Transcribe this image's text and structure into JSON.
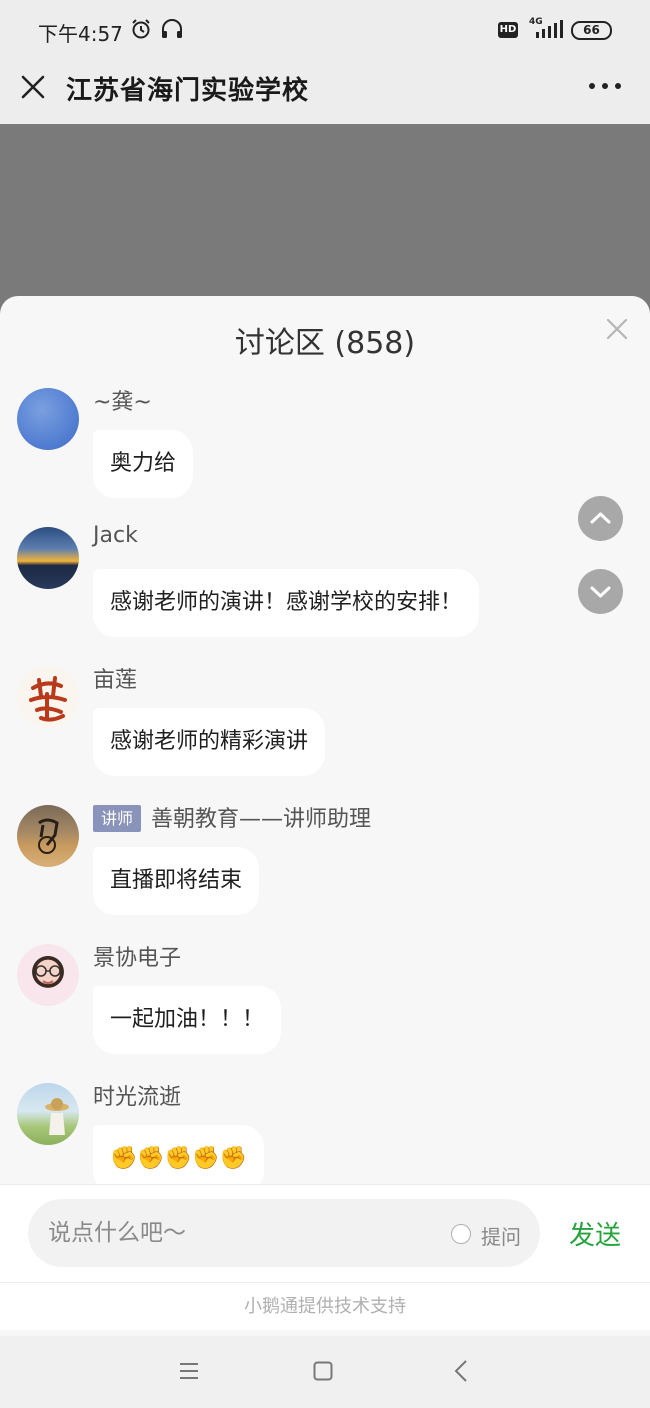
{
  "status_bar": {
    "time": "下午4:57",
    "network": "4G",
    "battery": "66",
    "hd_badge": "HD",
    "icons": [
      "alarm-icon",
      "headset-icon",
      "hd-icon",
      "signal-icon",
      "battery-icon"
    ]
  },
  "title_bar": {
    "title": "江苏省海门实验学校",
    "icons": [
      "close-icon",
      "more-icon"
    ]
  },
  "discussion": {
    "title": "讨论区 (858)",
    "messages": [
      {
        "user": "~龚~",
        "text": "奥力给",
        "avatar": "avatar-blue-circle"
      },
      {
        "user": "Jack",
        "text": "感谢老师的演讲！感谢学校的安排！",
        "avatar": "avatar-sunset"
      },
      {
        "user": "亩莲",
        "text": "感谢老师的精彩演讲",
        "avatar": "avatar-calligraphy"
      },
      {
        "user": "善朝教育——讲师助理",
        "role": "讲师",
        "text": "直播即将结束",
        "avatar": "avatar-desert-bike"
      },
      {
        "user": "景协电子",
        "text": "一起加油！！！",
        "avatar": "avatar-girl"
      },
      {
        "user": "时光流逝",
        "text": "✊✊✊✊✊",
        "avatar": "avatar-field"
      }
    ],
    "scroll_buttons": [
      "chevron-up-icon",
      "chevron-down-icon"
    ]
  },
  "composer": {
    "placeholder": "说点什么吧～",
    "value": "",
    "ask_label": "提问",
    "send_label": "发送"
  },
  "footer": {
    "support_text": "小鹅通提供技术支持"
  },
  "colors": {
    "send": "#26a33d",
    "video_bg": "#7a7a7a",
    "badge": "#8a93ba",
    "scroll_button": "#a8a8a8"
  }
}
